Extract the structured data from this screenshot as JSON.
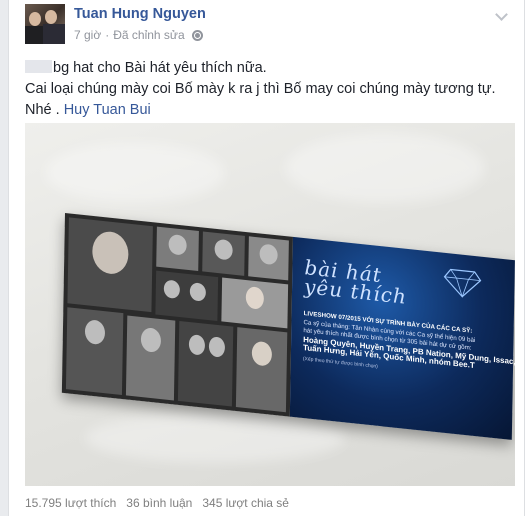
{
  "post": {
    "author": "Tuan Hung Nguyen",
    "time": "7 giờ",
    "edited": "Đã chỉnh sửa",
    "privacy_icon": "globe-icon",
    "menu_icon": "chevron-down-icon",
    "text_line1": "bg hat cho Bài hát yêu thích nữa.",
    "text_line2": "Cai loại chúng mày coi Bố mày k ra j thì Bố may coi chúng mày tương tự.",
    "text_line3": "Nhé .",
    "tagged_user": "Huy Tuan Bui"
  },
  "photo": {
    "show_title_1": "bài hát",
    "show_title_2": "yêu thích",
    "line1": "LIVESHOW 07/2015 VỚI SỰ TRÌNH BÀY CỦA CÁC CA SỸ:",
    "line2": "Ca sỹ của tháng:",
    "line2_name": "Tân Nhàn",
    "line2_rest": "cùng với các Ca sỹ thể hiện 09 bài",
    "line3": "hát yêu thích nhất được bình chọn từ 305 bài hát dự cử gồm:",
    "line4": "Hoàng Quyên, Huyền Trang, PB Nation, Mỹ Dung, Issac,",
    "line5": "Tuấn Hưng, Hải Yến, Quốc Minh, nhóm Bee.T",
    "line6": "(Xếp theo thứ tự được bình chọn)"
  },
  "footer": {
    "likes": "15.795 lượt thích",
    "comments": "36 bình luận",
    "shares": "345 lượt chia sẻ"
  }
}
